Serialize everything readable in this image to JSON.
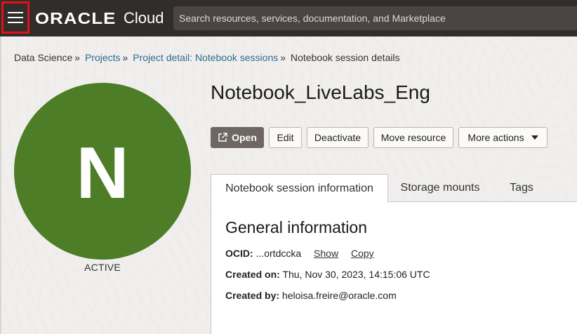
{
  "header": {
    "logo_brand": "ORACLE",
    "logo_product": "Cloud",
    "search_placeholder": "Search resources, services, documentation, and Marketplace"
  },
  "breadcrumb": {
    "root": "Data Science",
    "items": [
      "Projects",
      "Project detail: Notebook sessions"
    ],
    "current": "Notebook session details",
    "separator": "»"
  },
  "avatar": {
    "letter": "N",
    "color": "#4e7d27"
  },
  "status": "ACTIVE",
  "page_title": "Notebook_LiveLabs_Eng",
  "actions": {
    "open": "Open",
    "edit": "Edit",
    "deactivate": "Deactivate",
    "move": "Move resource",
    "more": "More actions"
  },
  "tabs": [
    "Notebook session information",
    "Storage mounts",
    "Tags"
  ],
  "general": {
    "title": "General information",
    "ocid_label": "OCID:",
    "ocid_value": "...ortdccka",
    "show": "Show",
    "copy": "Copy",
    "created_on_label": "Created on:",
    "created_on_value": "Thu, Nov 30, 2023, 14:15:06 UTC",
    "created_by_label": "Created by:",
    "created_by_value": "heloisa.freire@oracle.com"
  },
  "colors": {
    "topbar": "#312d2a",
    "highlight": "#e0111b",
    "link": "#2d6a8e",
    "open_button": "#6d6663"
  }
}
